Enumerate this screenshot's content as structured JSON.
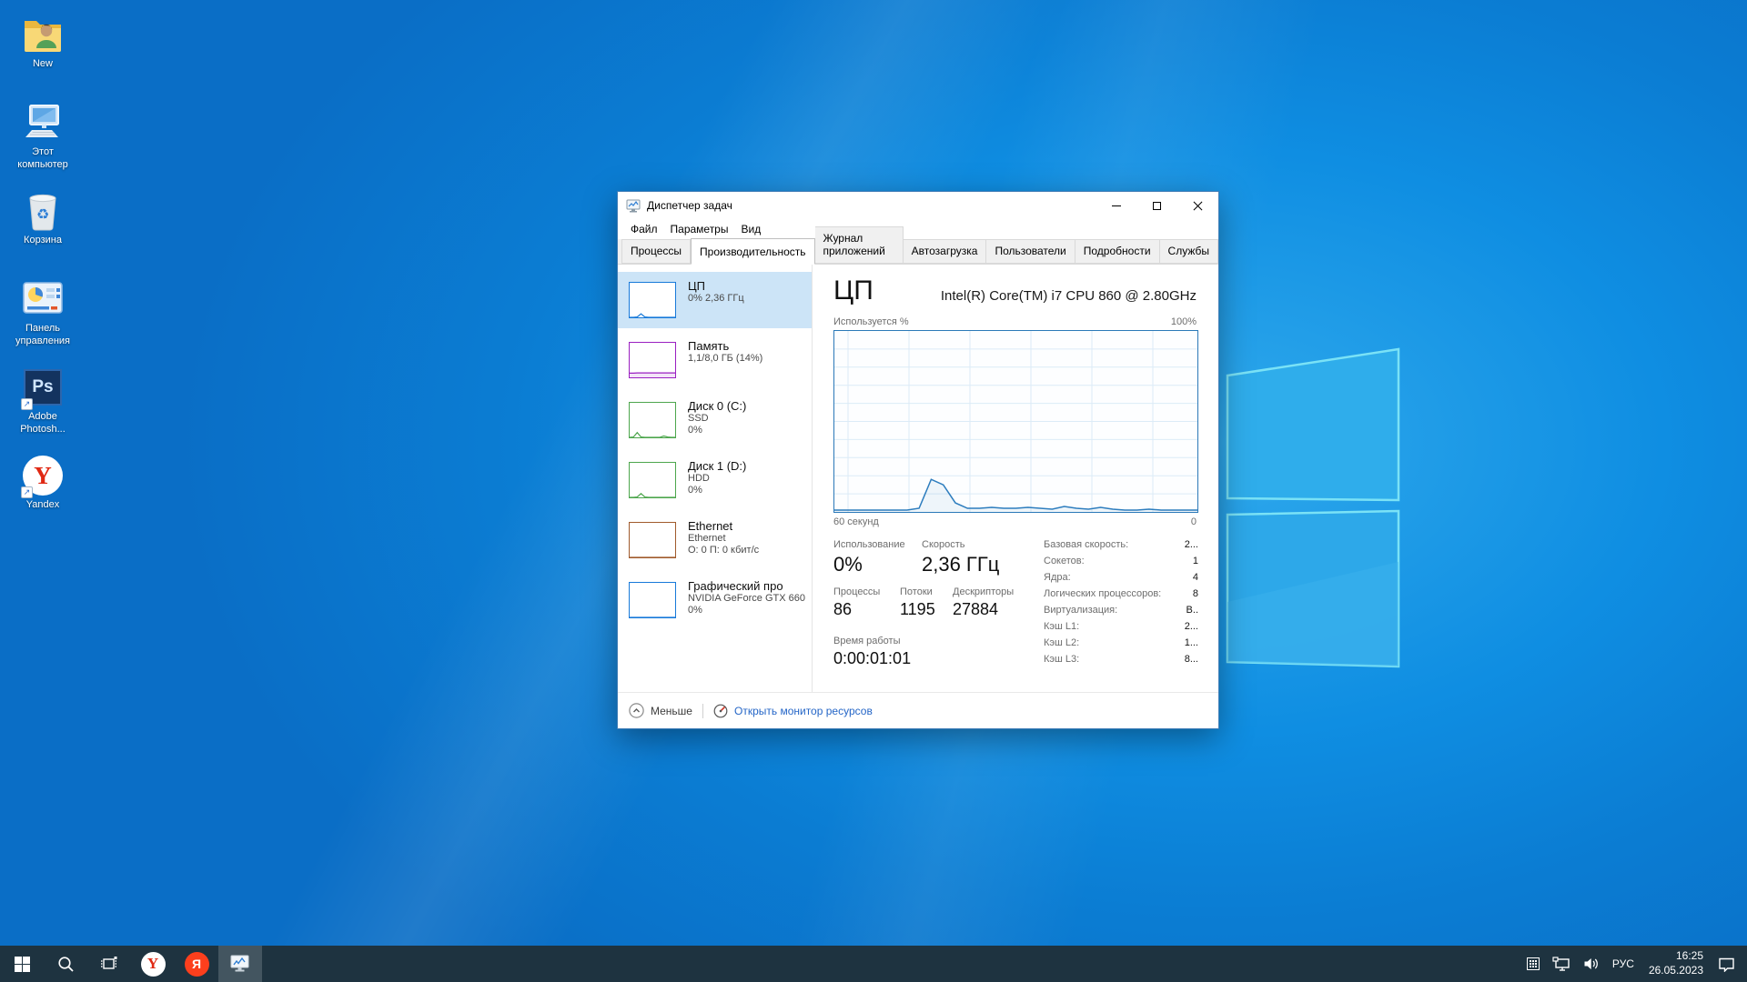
{
  "desktop": {
    "icons": [
      {
        "type": "user-folder",
        "lines": [
          "New"
        ]
      },
      {
        "type": "this-pc",
        "lines": [
          "Этот",
          "компьютер"
        ]
      },
      {
        "type": "recycle-bin",
        "lines": [
          "Корзина"
        ]
      },
      {
        "type": "control-panel",
        "lines": [
          "Панель",
          "управления"
        ]
      },
      {
        "type": "photoshop",
        "lines": [
          "Adobe",
          "Photosh..."
        ]
      },
      {
        "type": "yandex",
        "lines": [
          "Yandex"
        ]
      }
    ]
  },
  "window": {
    "title": "Диспетчер задач",
    "menu": [
      "Файл",
      "Параметры",
      "Вид"
    ],
    "tabs": {
      "items": [
        "Процессы",
        "Производительность",
        "Журнал приложений",
        "Автозагрузка",
        "Пользователи",
        "Подробности",
        "Службы"
      ],
      "active_index": 1
    },
    "sidebar": [
      {
        "title": "ЦП",
        "lines": [
          "0% 2,36 ГГц"
        ],
        "color": "#1779d9",
        "selected": true,
        "spark": [
          0,
          0,
          1,
          10,
          1,
          0,
          0,
          0,
          0,
          0,
          0,
          0,
          0
        ]
      },
      {
        "title": "Память",
        "lines": [
          "1,1/8,0 ГБ (14%)"
        ],
        "color": "#9a1fc1",
        "area": true,
        "spark": [
          12,
          12,
          13,
          13,
          13,
          13,
          13,
          13,
          13,
          13,
          13,
          13,
          13
        ]
      },
      {
        "title": "Диск 0 (C:)",
        "lines": [
          "SSD",
          "0%"
        ],
        "color": "#4da64d",
        "spark": [
          0,
          1,
          14,
          1,
          0,
          0,
          0,
          0,
          0,
          4,
          1,
          0,
          0
        ]
      },
      {
        "title": "Диск 1 (D:)",
        "lines": [
          "HDD",
          "0%"
        ],
        "color": "#4da64d",
        "spark": [
          0,
          0,
          1,
          11,
          1,
          0,
          0,
          0,
          0,
          0,
          0,
          0,
          0
        ]
      },
      {
        "title": "Ethernet",
        "lines": [
          "Ethernet",
          "О: 0 П: 0 кбит/с"
        ],
        "color": "#a05a2c",
        "spark": [
          0,
          0,
          0,
          0,
          0,
          0,
          0,
          0,
          0,
          0,
          0,
          0,
          0
        ]
      },
      {
        "title": "Графический про",
        "lines": [
          "NVIDIA GeForce GTX 660",
          "0%"
        ],
        "color": "#1779d9",
        "spark": [
          0,
          0,
          0,
          0,
          0,
          0,
          0,
          0,
          0,
          0,
          0,
          0,
          0
        ]
      }
    ],
    "main": {
      "heading": "ЦП",
      "subheading": "Intel(R) Core(TM) i7 CPU 860 @ 2.80GHz",
      "graph": {
        "top_left": "Используется %",
        "top_right": "100%",
        "bottom_left": "60 секунд",
        "bottom_right": "0"
      },
      "stats": {
        "row1": [
          {
            "label": "Использование",
            "value": "0%"
          },
          {
            "label": "Скорость",
            "value": "2,36 ГГц"
          }
        ],
        "row2": [
          {
            "label": "Процессы",
            "value": "86"
          },
          {
            "label": "Потоки",
            "value": "1195"
          },
          {
            "label": "Дескрипторы",
            "value": "27884"
          }
        ],
        "uptime": {
          "label": "Время работы",
          "value": "0:00:01:01"
        },
        "right": [
          {
            "label": "Базовая скорость:",
            "value": "2..."
          },
          {
            "label": "Сокетов:",
            "value": "1"
          },
          {
            "label": "Ядра:",
            "value": "4"
          },
          {
            "label": "Логических процессоров:",
            "value": "8"
          },
          {
            "label": "Виртуализация:",
            "value": "В.."
          },
          {
            "label": "Кэш L1:",
            "value": "2..."
          },
          {
            "label": "Кэш L2:",
            "value": "1..."
          },
          {
            "label": "Кэш L3:",
            "value": "8..."
          }
        ]
      }
    },
    "footer": {
      "less": "Меньше",
      "resmon": "Открыть монитор ресурсов"
    }
  },
  "taskbar": {
    "tray": {
      "language": "РУС",
      "time": "16:25",
      "date": "26.05.2023"
    }
  },
  "chart_data": {
    "type": "line",
    "title": "ЦП — Используется %",
    "xlabel": "60 секунд",
    "ylabel": "Используется %",
    "ylim": [
      0,
      100
    ],
    "x_range_seconds": [
      60,
      0
    ],
    "values": [
      1,
      1,
      1,
      1,
      1,
      1,
      1,
      2,
      18,
      15,
      5,
      2,
      2,
      2.5,
      2,
      2,
      2.5,
      2,
      1.5,
      3,
      2,
      1.5,
      2.5,
      1.5,
      1,
      1,
      1.5,
      1,
      1,
      1,
      1
    ]
  },
  "colors": {
    "selected_bg": "#cce4f7",
    "link": "#2566c7",
    "graph_border": "#2b79b8",
    "graph_grid": "#dcebf7",
    "graph_line": "#2d7dbe",
    "taskbar": "#1e3340"
  }
}
